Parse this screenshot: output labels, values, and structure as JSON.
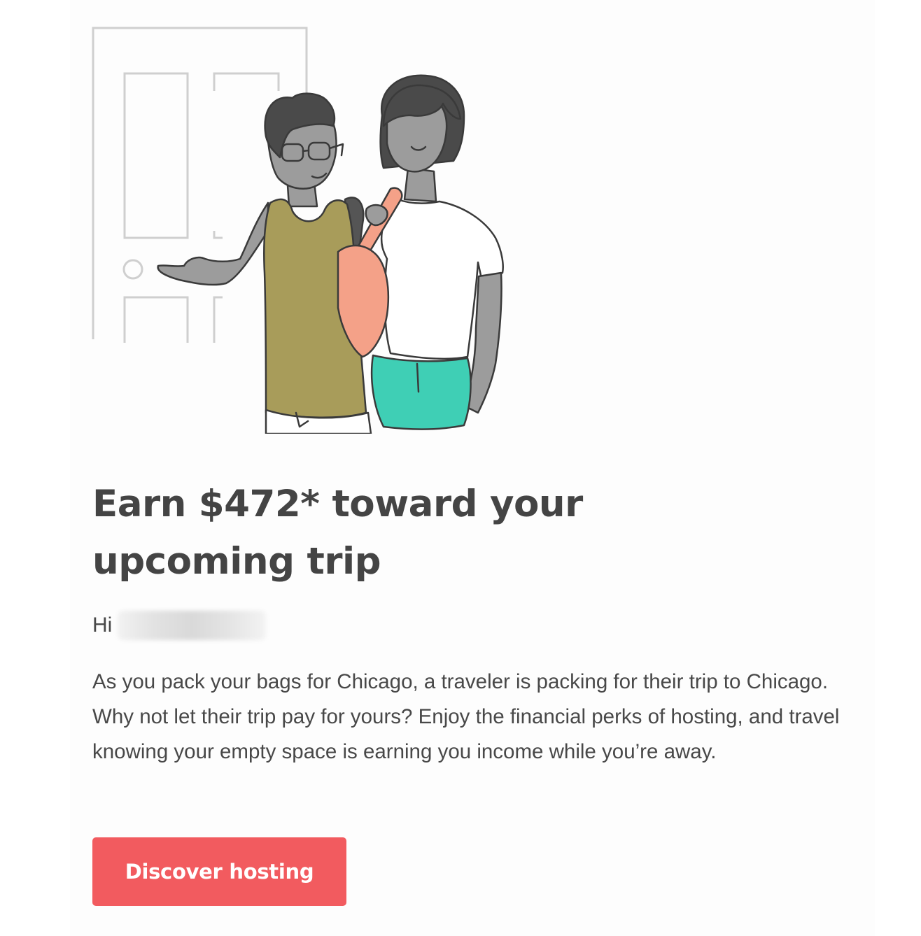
{
  "illustration": {
    "icon": "hosts-greeting-at-door-illustration",
    "colors": {
      "line": "#3a3a3a",
      "door": "#cfcfcf",
      "skin": "#9c9c9c",
      "hair": "#4a4a4a",
      "tank_top": "#a89c5a",
      "bag": "#f4a188",
      "shorts": "#3fcfb5",
      "shirt": "#ffffff"
    }
  },
  "email": {
    "headline_line1": "Earn $472* toward your",
    "headline_line2": "upcoming trip",
    "greeting": "Hi",
    "body": "As you pack your bags for Chicago, a traveler is packing for their trip to Chicago. Why not let their trip pay for yours? Enjoy the financial perks of hosting, and travel knowing your empty space is earning you income while you’re away.",
    "cta_label": "Discover hosting"
  },
  "colors": {
    "accent": "#f25b5f",
    "text": "#484848",
    "headline": "#444444"
  }
}
